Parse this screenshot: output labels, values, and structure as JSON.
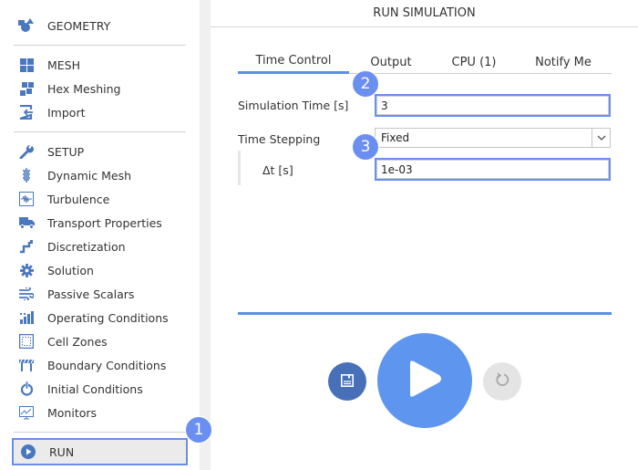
{
  "sidebar": {
    "sections": [
      {
        "label": "GEOMETRY",
        "icon": "geometry-shapes-icon"
      },
      {
        "label": "MESH",
        "icon": "mesh-grid-icon"
      },
      {
        "label": "Hex Meshing",
        "icon": "hex-meshing-icon"
      },
      {
        "label": "Import",
        "icon": "import-icon"
      },
      {
        "label": "SETUP",
        "icon": "wrench-icon"
      },
      {
        "label": "Dynamic Mesh",
        "icon": "spring-icon"
      },
      {
        "label": "Turbulence",
        "icon": "waveform-icon"
      },
      {
        "label": "Transport Properties",
        "icon": "truck-icon"
      },
      {
        "label": "Discretization",
        "icon": "discretization-icon"
      },
      {
        "label": "Solution",
        "icon": "gear-icon"
      },
      {
        "label": "Passive Scalars",
        "icon": "wind-icon"
      },
      {
        "label": "Operating Conditions",
        "icon": "bar-chart-icon"
      },
      {
        "label": "Cell Zones",
        "icon": "cell-zone-icon"
      },
      {
        "label": "Boundary Conditions",
        "icon": "barrier-icon"
      },
      {
        "label": "Initial Conditions",
        "icon": "power-icon"
      },
      {
        "label": "Monitors",
        "icon": "monitor-chart-icon"
      }
    ],
    "run": {
      "label": "RUN",
      "icon": "play-circle-icon"
    }
  },
  "main": {
    "title": "RUN SIMULATION",
    "tabs": [
      {
        "label": "Time Control",
        "active": true
      },
      {
        "label": "Output",
        "active": false
      },
      {
        "label": "CPU  (1)",
        "active": false
      },
      {
        "label": "Notify Me",
        "active": false
      }
    ],
    "fields": {
      "simulation_time": {
        "label": "Simulation Time [s]",
        "value": "3"
      },
      "time_stepping": {
        "label": "Time Stepping",
        "value": "Fixed"
      },
      "delta_t": {
        "label": "Δt [s]",
        "value": "1e-03"
      }
    },
    "progress": 1.0,
    "actions": {
      "save": "save-icon",
      "play": "play-icon",
      "reset": "reset-icon"
    }
  },
  "annotations": [
    "1",
    "2",
    "3"
  ],
  "colors": {
    "accent": "#5a8fe6",
    "badge": "#6b8ff0",
    "icon": "#4a78bf",
    "save_button": "#4870b8",
    "play_button": "#5e96ef",
    "reset_button": "#e4e4e4"
  }
}
